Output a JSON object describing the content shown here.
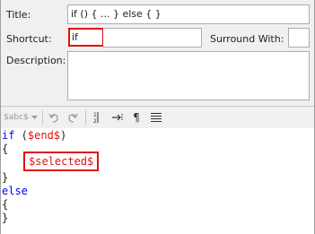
{
  "form": {
    "title_label": "Title:",
    "title_value": "if () { ... } else { }",
    "shortcut_label": "Shortcut:",
    "shortcut_value": "if",
    "surround_label": "Surround With:",
    "surround_value": "",
    "description_label": "Description:",
    "description_value": ""
  },
  "toolbar": {
    "variable_dropdown": "$abc$",
    "undo_icon": "undo-icon",
    "redo_icon": "redo-icon",
    "line_numbers_icon": "line-numbers-icon",
    "tab_icon": "show-tabs-icon",
    "pilcrow": "¶",
    "wrap_icon": "word-wrap-icon"
  },
  "editor": {
    "line1_kw": "if",
    "line1_open": " (",
    "line1_ph": "$end$",
    "line1_close": ")",
    "line2": "{",
    "placeholder": "$selected$",
    "line4": "}",
    "line5_kw": "else",
    "line6": "{",
    "line7": "}"
  },
  "colors": {
    "keyword": "#0000ff",
    "placeholder": "#e01010",
    "highlight_border": "#e01010"
  }
}
